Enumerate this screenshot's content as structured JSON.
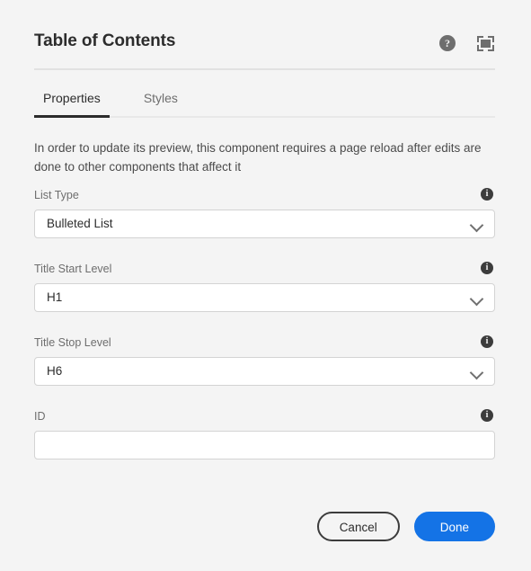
{
  "dialog": {
    "title": "Table of Contents",
    "help_icon": "help-circle-icon",
    "help_glyph": "?",
    "fullscreen_icon": "fullscreen-expand-icon"
  },
  "tabs": [
    {
      "label": "Properties",
      "active": true
    },
    {
      "label": "Styles",
      "active": false
    }
  ],
  "description": "In order to update its preview, this component requires a page reload after edits are done to other components that affect it",
  "info_glyph": "i",
  "fields": [
    {
      "label": "List Type",
      "type": "select",
      "value": "Bulleted List",
      "info_icon": "info-icon",
      "chevron_icon": "chevron-down-icon"
    },
    {
      "label": "Title Start Level",
      "type": "select",
      "value": "H1",
      "info_icon": "info-icon",
      "chevron_icon": "chevron-down-icon"
    },
    {
      "label": "Title Stop Level",
      "type": "select",
      "value": "H6",
      "info_icon": "info-icon",
      "chevron_icon": "chevron-down-icon"
    },
    {
      "label": "ID",
      "type": "text",
      "value": "",
      "placeholder": "",
      "info_icon": "info-icon"
    }
  ],
  "footer": {
    "cancel_label": "Cancel",
    "done_label": "Done"
  },
  "colors": {
    "background": "#f4f4f4",
    "primary_button": "#1473e6",
    "text_primary": "#2c2c2c",
    "text_secondary": "#6e6e6e",
    "field_border": "#d3d3d3",
    "divider": "#e1e1e1"
  }
}
